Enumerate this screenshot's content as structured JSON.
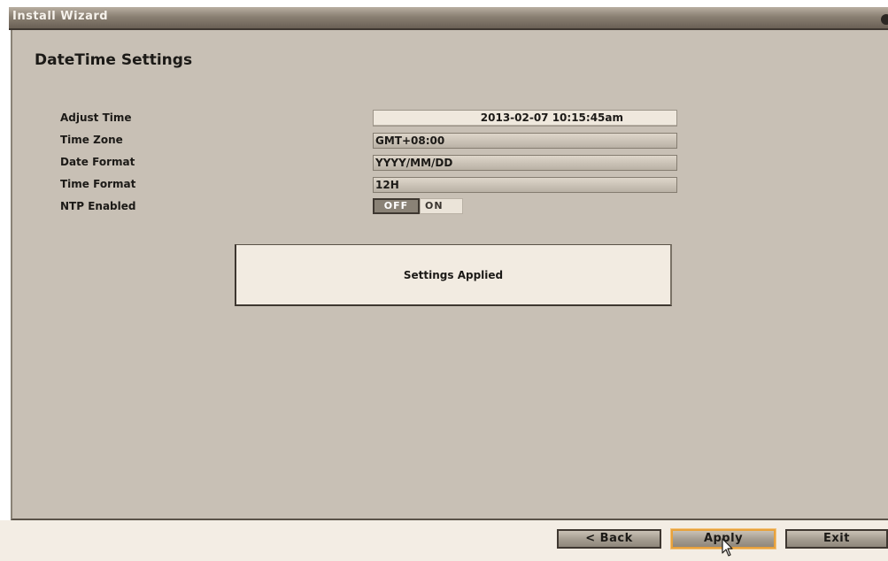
{
  "window": {
    "title": "Install Wizard"
  },
  "page": {
    "title": "DateTime Settings"
  },
  "form": {
    "adjust_time": {
      "label": "Adjust Time",
      "value": "2013-02-07 10:15:45am"
    },
    "time_zone": {
      "label": "Time Zone",
      "value": "GMT+08:00"
    },
    "date_format": {
      "label": "Date Format",
      "value": "YYYY/MM/DD"
    },
    "time_format": {
      "label": "Time Format",
      "value": "12H"
    },
    "ntp_enabled": {
      "label": "NTP Enabled",
      "off_label": "OFF",
      "on_label": "ON",
      "selected": "OFF"
    }
  },
  "message": {
    "text": "Settings Applied"
  },
  "footer": {
    "back_label": "< Back",
    "apply_label": "Apply",
    "exit_label": "Exit"
  },
  "colors": {
    "panel_bg": "#c8c0b5",
    "footer_bg": "#f3ede4",
    "focus_accent": "#e8a23c"
  }
}
